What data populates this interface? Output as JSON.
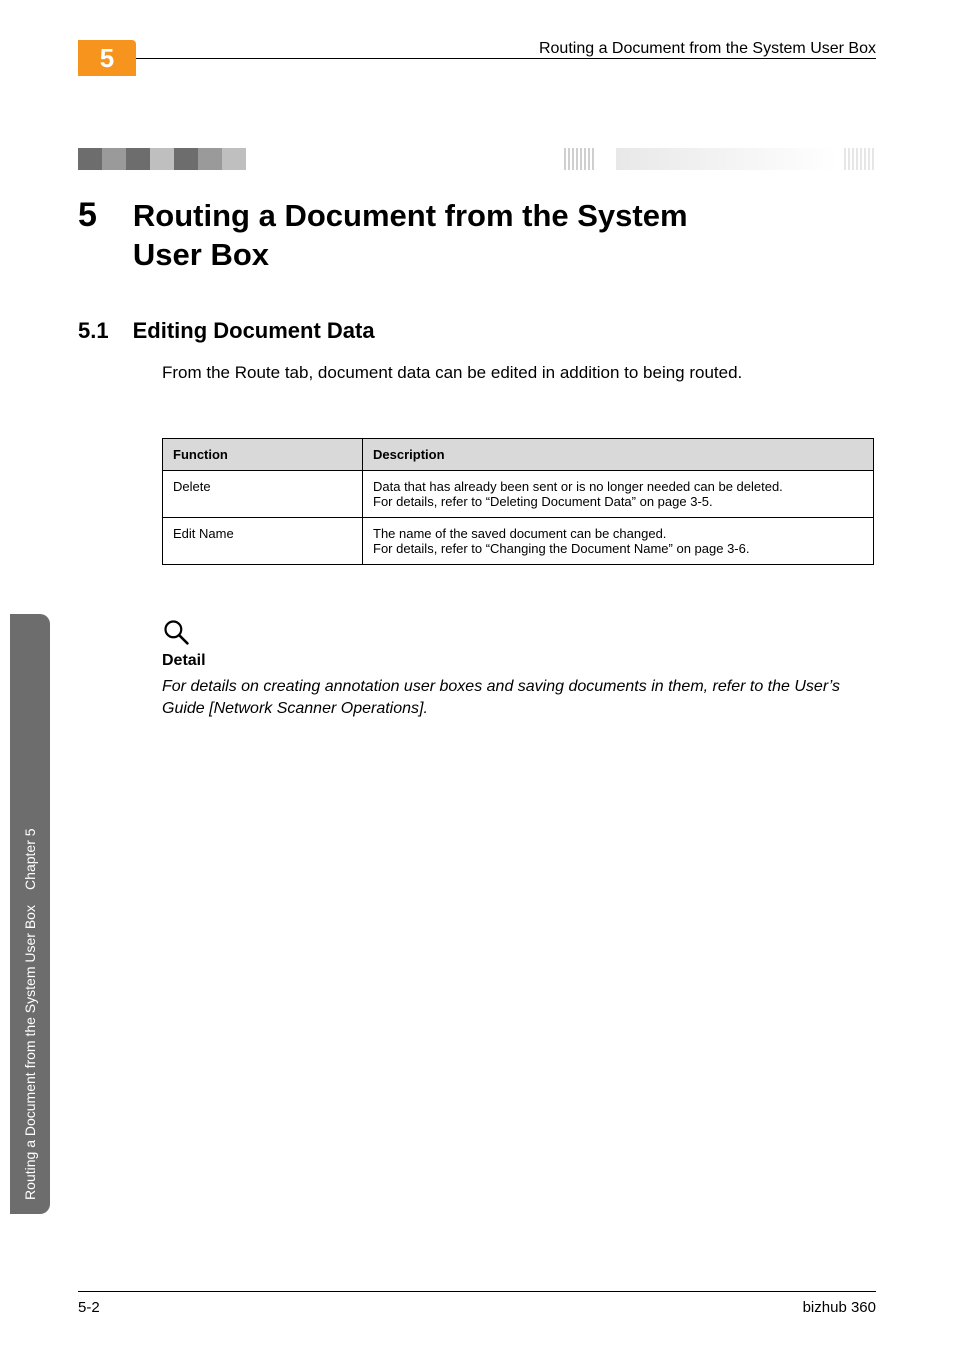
{
  "header": {
    "chapter_tab": "5",
    "running_head": "Routing a Document from the System User Box"
  },
  "h1": {
    "num": "5",
    "title_line1": "Routing a Document from the System",
    "title_line2": "User Box"
  },
  "h2": {
    "num": "5.1",
    "title": "Editing Document Data"
  },
  "intro": "From the Route tab, document data can be edited in addition to being routed.",
  "table": {
    "head": {
      "c1": "Function",
      "c2": "Description"
    },
    "rows": [
      {
        "c1": "Delete",
        "c2": "Data that has already been sent or is no longer needed can be deleted.\nFor details, refer to “Deleting Document Data” on page 3-5."
      },
      {
        "c1": "Edit Name",
        "c2": "The name of the saved document can be changed.\nFor details, refer to “Changing the Document Name” on page 3-6."
      }
    ]
  },
  "detail": {
    "label": "Detail",
    "text": "For details on creating annotation user boxes and saving documents in them, refer to the User’s Guide [Network Scanner Operations]."
  },
  "side": {
    "chapter": "Chapter 5",
    "title": "Routing a Document from the System User Box"
  },
  "footer": {
    "left": "5-2",
    "right": "bizhub 360"
  },
  "chart_data": {
    "type": "table",
    "title": "Editing Document Data — Route tab functions",
    "columns": [
      "Function",
      "Description"
    ],
    "rows": [
      [
        "Delete",
        "Data that has already been sent or is no longer needed can be deleted. For details, refer to “Deleting Document Data” on page 3-5."
      ],
      [
        "Edit Name",
        "The name of the saved document can be changed. For details, refer to “Changing the Document Name” on page 3-6."
      ]
    ]
  }
}
